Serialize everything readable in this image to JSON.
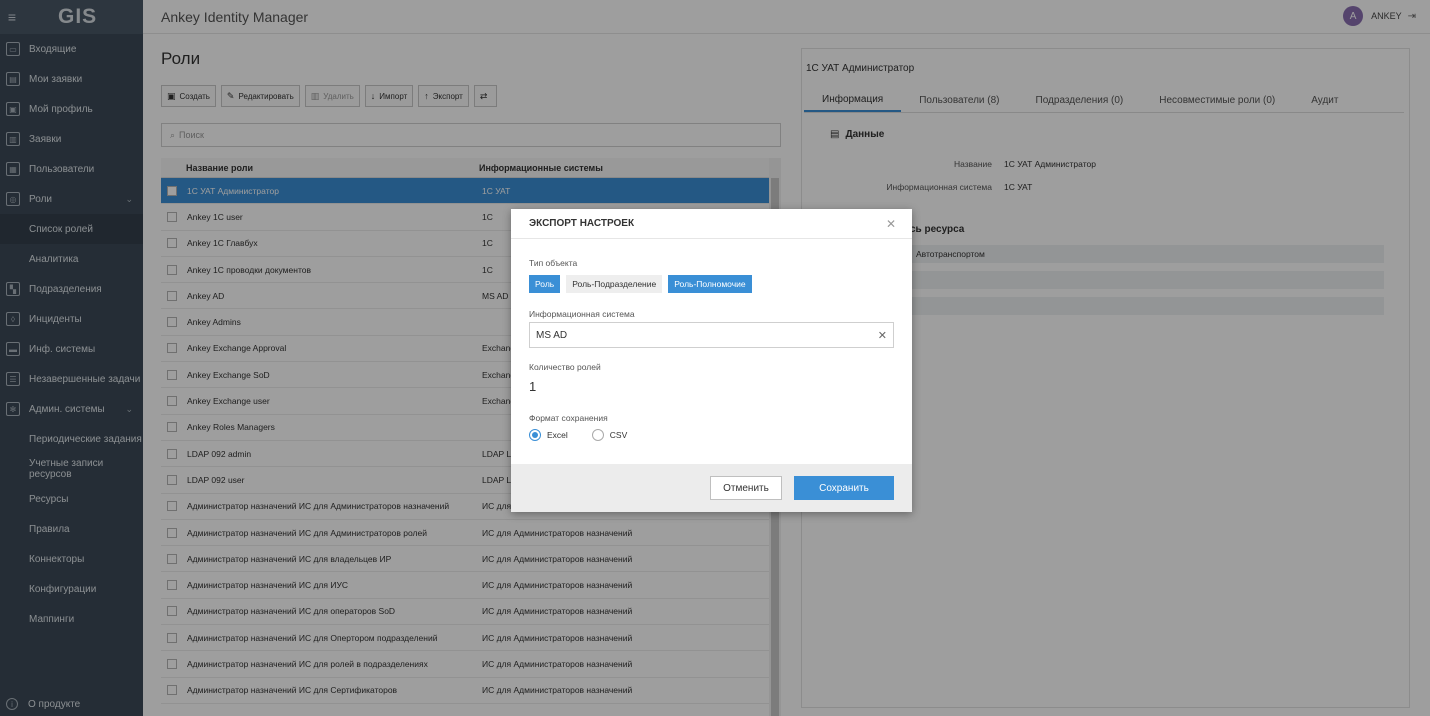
{
  "sidebar": {
    "logo": "GIS",
    "items": [
      {
        "label": "Входящие",
        "icon": "inbox-icon"
      },
      {
        "label": "Мои заявки",
        "icon": "requests-icon"
      },
      {
        "label": "Мой профиль",
        "icon": "profile-icon"
      },
      {
        "label": "Заявки",
        "icon": "clipboard-icon"
      },
      {
        "label": "Пользователи",
        "icon": "users-icon"
      },
      {
        "label": "Роли",
        "icon": "roles-icon"
      }
    ],
    "roles_sub": [
      "Список ролей",
      "Аналитика"
    ],
    "items2": [
      {
        "label": "Подразделения",
        "icon": "building-icon"
      },
      {
        "label": "Инциденты",
        "icon": "shield-icon"
      },
      {
        "label": "Инф. системы",
        "icon": "database-icon"
      },
      {
        "label": "Незавершенные задачи",
        "icon": "tasks-icon"
      },
      {
        "label": "Админ. системы",
        "icon": "gear-icon"
      }
    ],
    "admin_sub": [
      "Периодические задания",
      "Учетные записи ресурсов",
      "Ресурсы",
      "Правила",
      "Коннекторы",
      "Конфигурации",
      "Маппинги"
    ],
    "about": "О продукте"
  },
  "header": {
    "title": "Ankey Identity Manager",
    "avatar_letter": "A",
    "username": "ANKEY"
  },
  "main": {
    "title": "Роли",
    "toolbar": {
      "create": "Создать",
      "edit": "Редактировать",
      "delete": "Удалить",
      "import": "Импорт",
      "export": "Экспорт"
    },
    "search_placeholder": "Поиск",
    "columns": [
      "Название роли",
      "Информационные системы"
    ],
    "rows": [
      [
        "1С УАТ Администратор",
        "1С УАТ"
      ],
      [
        "Ankey 1C user",
        "1С"
      ],
      [
        "Ankey 1C Главбух",
        "1С"
      ],
      [
        "Ankey 1C проводки документов",
        "1С"
      ],
      [
        "Ankey AD",
        "MS AD"
      ],
      [
        "Ankey Admins",
        ""
      ],
      [
        "Ankey Exchange Approval",
        "Exchang"
      ],
      [
        "Ankey Exchange SoD",
        "Exchang"
      ],
      [
        "Ankey Exchange user",
        "Exchang"
      ],
      [
        "Ankey Roles Managers",
        ""
      ],
      [
        "LDAP 092 admin",
        "LDAP L"
      ],
      [
        "LDAP 092 user",
        "LDAP L"
      ],
      [
        "Администратор назначений ИС для Администраторов назначений",
        "ИС для Администраторов назначений"
      ],
      [
        "Администратор назначений ИС для Администраторов ролей",
        "ИС для Администраторов назначений"
      ],
      [
        "Администратор назначений ИС для владельцев ИР",
        "ИС для Администраторов назначений"
      ],
      [
        "Администратор назначений ИС для ИУС",
        "ИС для Администраторов назначений"
      ],
      [
        "Администратор назначений ИС для операторов SoD",
        "ИС для Администраторов назначений"
      ],
      [
        "Администратор назначений ИС для Опертором подразделений",
        "ИС для Администраторов назначений"
      ],
      [
        "Администратор назначений ИС для ролей в подразделениях",
        "ИС для Администраторов назначений"
      ],
      [
        "Администратор назначений ИС для Сертификаторов",
        "ИС для Администраторов назначений"
      ]
    ]
  },
  "detail": {
    "title": "1С УАТ Администратор",
    "tabs": [
      "Информация",
      "Пользователи (8)",
      "Подразделения (0)",
      "Несовместимые роли (0)",
      "Аудит"
    ],
    "section": "Данные",
    "props": [
      {
        "k": "Название",
        "v": "1С УАТ Администратор"
      },
      {
        "k": "Информационная система",
        "v": "1С УАТ"
      }
    ],
    "section2": "сь ресурса",
    "res_rows": [
      "Автотранспортом",
      "",
      ""
    ]
  },
  "modal": {
    "title": "ЭКСПОРТ НАСТРОЕК",
    "type_label": "Тип объекта",
    "types": [
      "Роль",
      "Роль-Подразделение",
      "Роль-Полномочие"
    ],
    "system_label": "Информационная система",
    "system_value": "MS AD",
    "count_label": "Количество ролей",
    "count_value": "1",
    "format_label": "Формат сохранения",
    "formats": [
      "Excel",
      "CSV"
    ],
    "cancel": "Отменить",
    "save": "Сохранить"
  }
}
